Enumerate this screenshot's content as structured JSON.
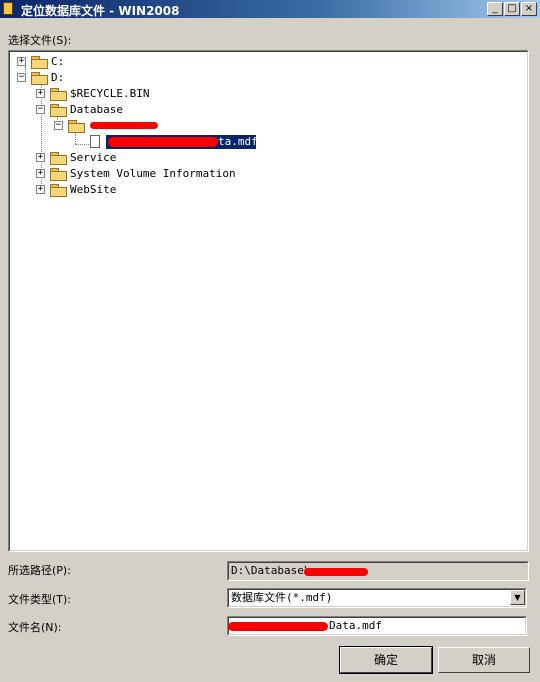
{
  "window": {
    "title": "定位数据库文件 - WIN2008",
    "controls": [
      "_",
      "□",
      "×"
    ]
  },
  "select_label": "选择文件(S):",
  "tree": {
    "drive_c": "C:",
    "drive_d": "D:",
    "recycle": "$RECYCLE.BIN",
    "database": "Database",
    "file_visible_suffix": "ta.mdf",
    "service": "Service",
    "svi": "System Volume Information",
    "website": "WebSite"
  },
  "path": {
    "label": "所选路径(P):",
    "value": "D:\\Database\\"
  },
  "filetype": {
    "label": "文件类型(T):",
    "value": "数据库文件(*.mdf)"
  },
  "filename": {
    "label": "文件名(N):",
    "value": "Data.mdf"
  },
  "buttons": {
    "ok": "确定",
    "cancel": "取消"
  }
}
